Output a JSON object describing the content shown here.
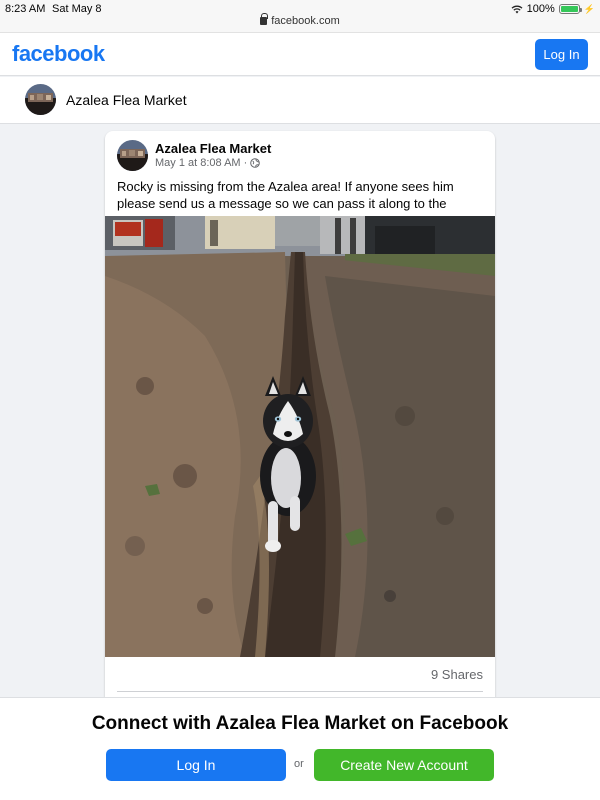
{
  "status_bar": {
    "time": "8:23 AM",
    "date": "Sat May 8",
    "url": "facebook.com",
    "battery": "100%",
    "battery_level": 1.0
  },
  "header": {
    "logo": "facebook",
    "login_label": "Log In"
  },
  "page": {
    "name": "Azalea Flea Market"
  },
  "post": {
    "author": "Azalea Flea Market",
    "timestamp": "May 1 at 8:08 AM",
    "separator": "·",
    "privacy_icon": "globe-icon",
    "text": "Rocky is missing from the Azalea area! If anyone sees him please send us a message so we can pass it along to the owner.",
    "photo_subject": "husky-puppy-in-trench",
    "shares": "9 Shares"
  },
  "prompt": {
    "title": "Connect with Azalea Flea Market on Facebook",
    "login_label": "Log In",
    "or_label": "or",
    "create_label": "Create New Account"
  },
  "colors": {
    "brand_blue": "#1877f2",
    "create_green": "#42b72a",
    "page_bg": "#f0f2f5"
  }
}
